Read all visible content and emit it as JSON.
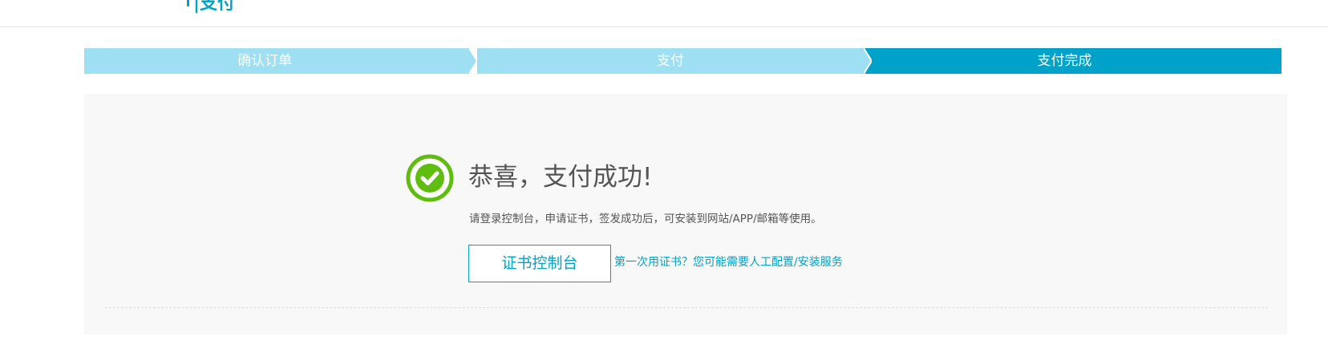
{
  "header": {
    "title": "|支付"
  },
  "steps": [
    {
      "label": "确认订单",
      "state": "done"
    },
    {
      "label": "支付",
      "state": "done"
    },
    {
      "label": "支付完成",
      "state": "current"
    }
  ],
  "result": {
    "icon": "check-circle-icon",
    "title": "恭喜，支付成功!",
    "description": "请登录控制台，申请证书，签发成功后，可安装到网站/APP/邮箱等使用。",
    "console_button_label": "证书控制台",
    "help_link_text": "第一次用证书？您可能需要人工配置/安装服务"
  },
  "colors": {
    "accent": "#00a2ca",
    "step_inactive": "#9fdff4",
    "success_green": "#5fbd10",
    "panel_bg": "#f8f8f8",
    "text": "#555555"
  }
}
